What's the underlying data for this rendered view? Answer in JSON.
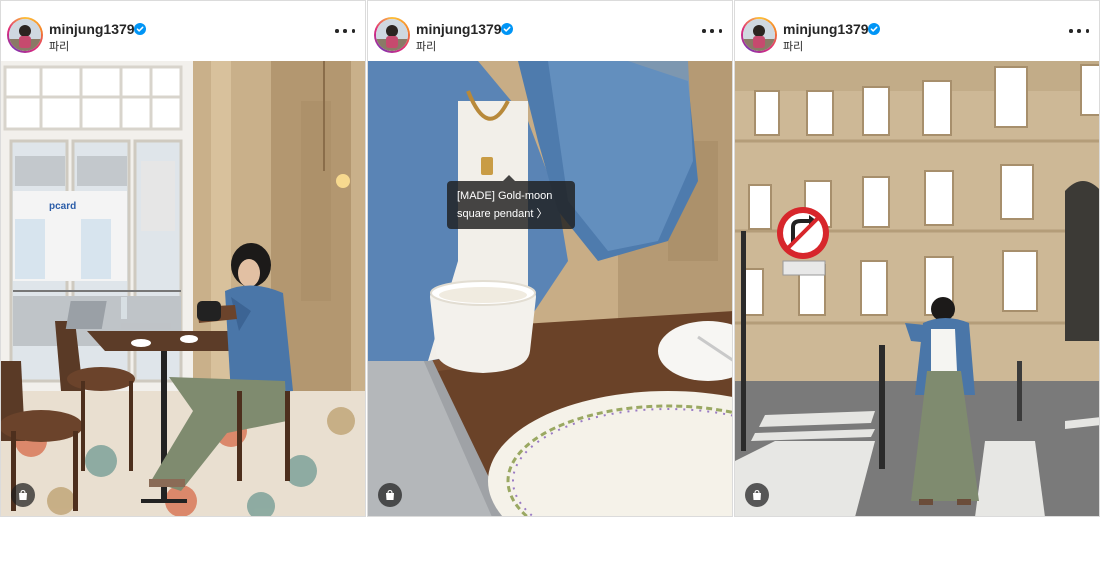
{
  "posts": [
    {
      "username": "minjung1379",
      "location": "파리",
      "more_icon": "more-horizontal-icon",
      "verified_icon": "verified-badge-icon",
      "shop_icon": "shopping-bag-icon",
      "sign_text": "pcard"
    },
    {
      "username": "minjung1379",
      "location": "파리",
      "more_icon": "more-horizontal-icon",
      "verified_icon": "verified-badge-icon",
      "shop_icon": "shopping-bag-icon",
      "product_tag": {
        "line1": "[MADE] Gold-moon",
        "line2": "square pendant 〉"
      }
    },
    {
      "username": "minjung1379",
      "location": "파리",
      "more_icon": "more-horizontal-icon",
      "verified_icon": "verified-badge-icon",
      "shop_icon": "shopping-bag-icon"
    }
  ],
  "colors": {
    "verified": "#0095f6",
    "text": "#262626",
    "border": "#dbdbdb"
  }
}
